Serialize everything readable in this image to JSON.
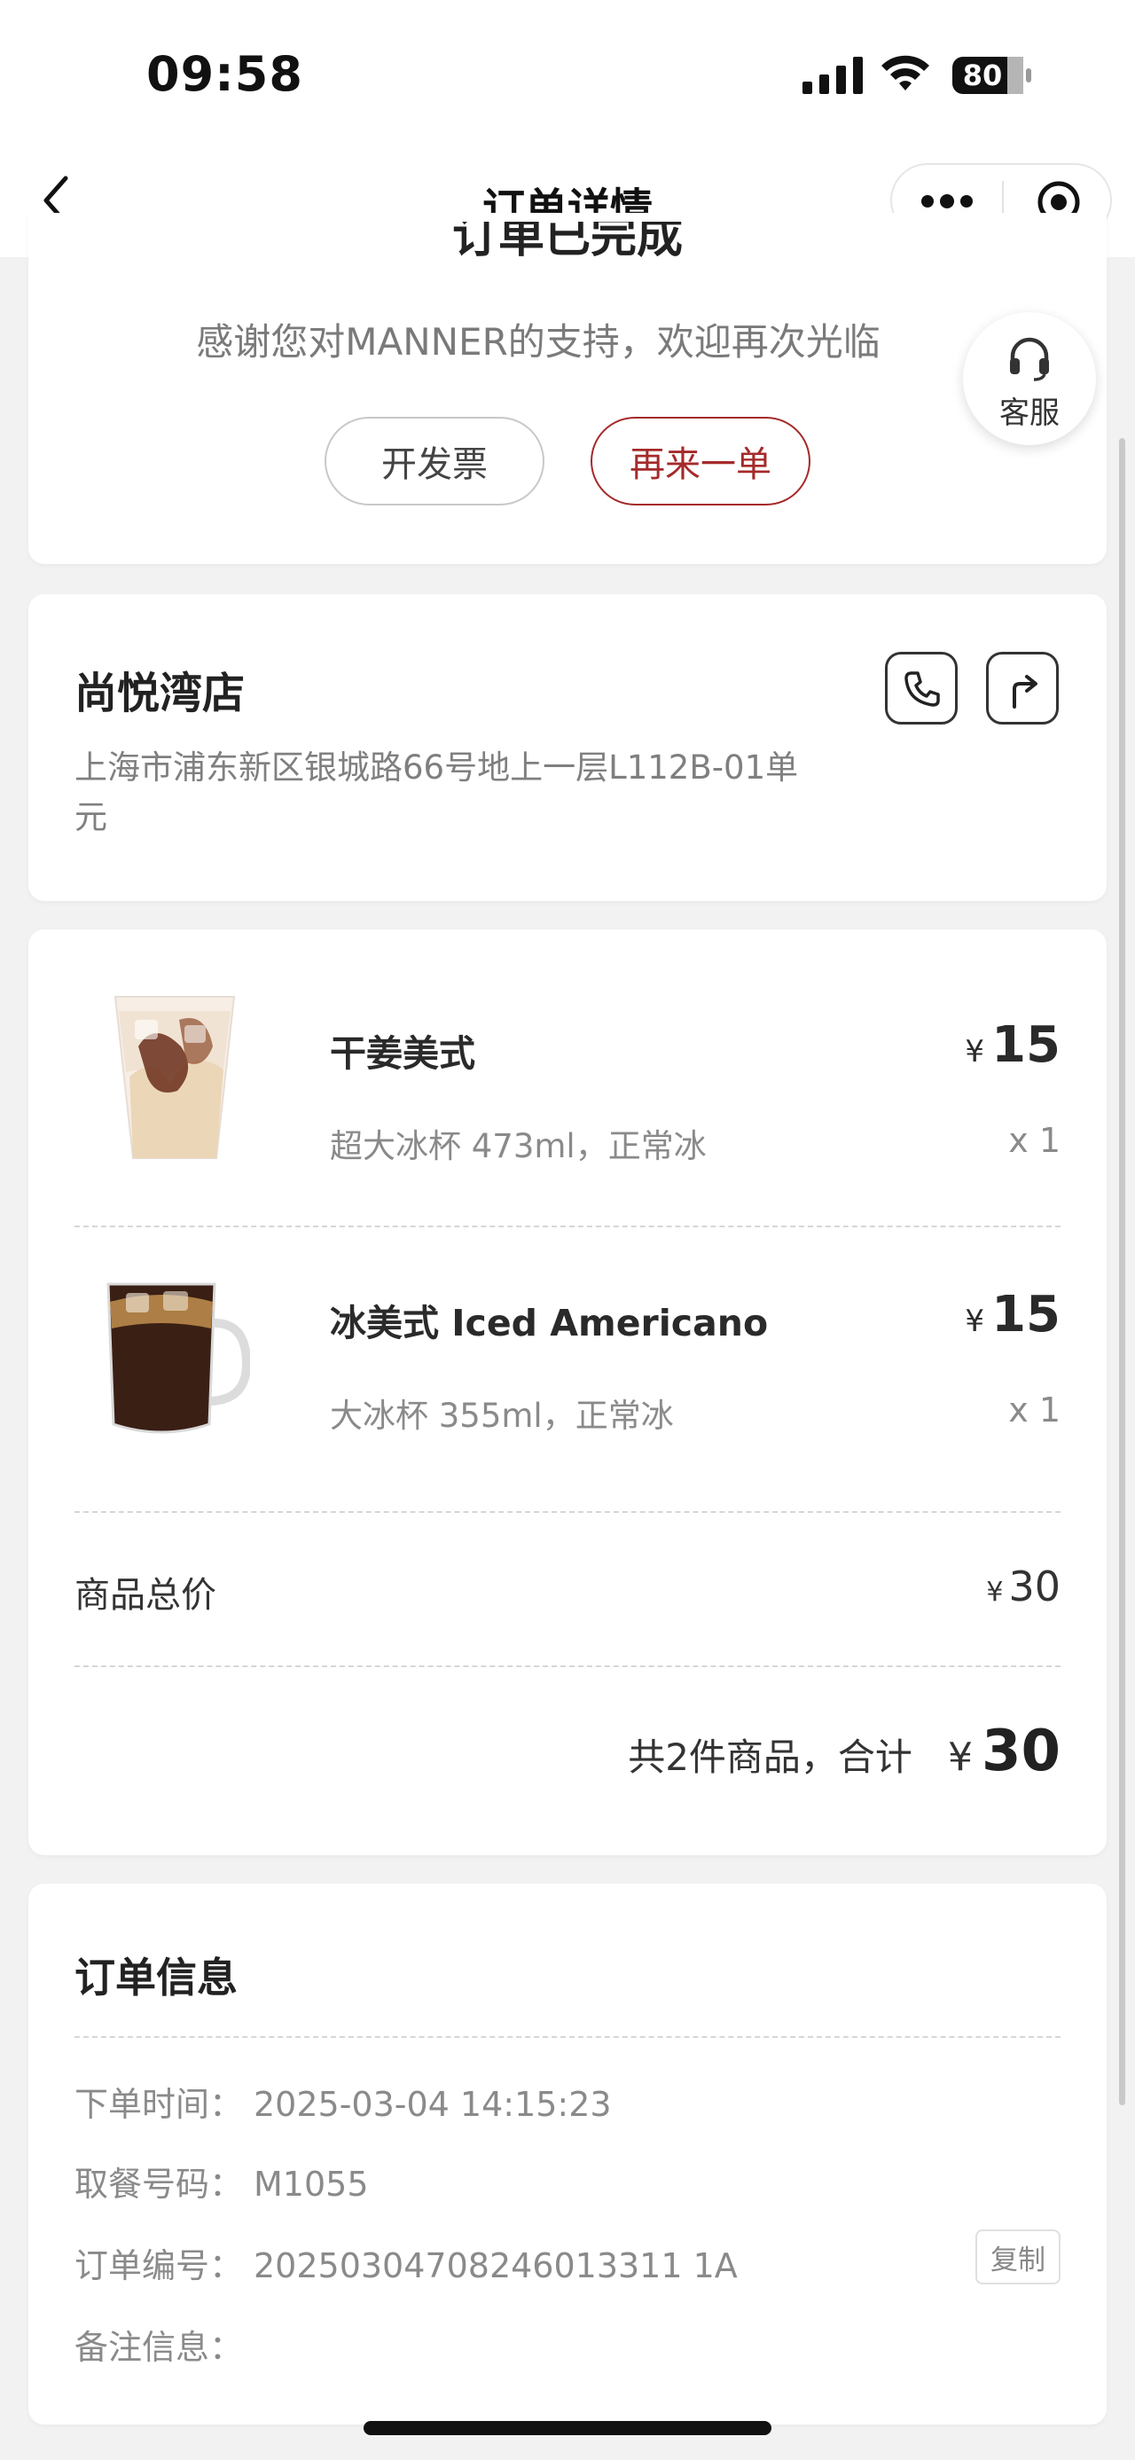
{
  "status_bar": {
    "time": "09:58",
    "battery": "80"
  },
  "nav": {
    "title": "订单详情"
  },
  "status_card": {
    "heading_partial": "订单已完成",
    "thanks": "感谢您对MANNER的支持，欢迎再次光临",
    "invoice_label": "开发票",
    "reorder_label": "再来一单"
  },
  "service": {
    "label": "客服"
  },
  "store": {
    "name": "尚悦湾店",
    "address": "上海市浦东新区银城路66号地上一层L112B-01单元"
  },
  "items": [
    {
      "name": "干姜美式",
      "spec": "超大冰杯 473ml，正常冰",
      "currency": "¥",
      "price": "15",
      "qty": "x 1"
    },
    {
      "name": "冰美式 Iced Americano",
      "spec": "大冰杯 355ml，正常冰",
      "currency": "¥",
      "price": "15",
      "qty": "x 1"
    }
  ],
  "summary": {
    "subtotal_label": "商品总价",
    "currency": "¥",
    "subtotal": "30",
    "total_text": "共2件商品，合计",
    "total": "30"
  },
  "order_info": {
    "title": "订单信息",
    "rows": [
      {
        "key": "下单时间：",
        "value": "2025-03-04 14:15:23"
      },
      {
        "key": "取餐号码：",
        "value": "M1055"
      },
      {
        "key": "订单编号：",
        "value": "20250304708246013311 1A"
      },
      {
        "key": "备注信息：",
        "value": ""
      }
    ],
    "copy_label": "复制"
  },
  "colors": {
    "accent": "#a52a2a",
    "background": "#f2f2f2",
    "card": "#ffffff"
  }
}
